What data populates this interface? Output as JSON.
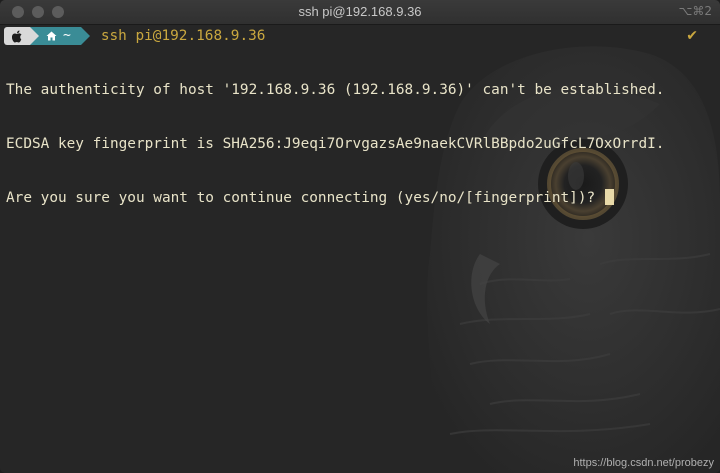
{
  "window": {
    "title": "ssh pi@192.168.9.36",
    "shortcut": "⌥⌘2"
  },
  "prompt": {
    "apple_icon": "apple-logo-icon",
    "home_icon": "home-icon",
    "dir": "~",
    "command": "ssh pi@192.168.9.36",
    "status_icon": "checkmark-icon",
    "status_glyph": "✔"
  },
  "output": {
    "line1": "The authenticity of host '192.168.9.36 (192.168.9.36)' can't be established.",
    "line2": "ECDSA key fingerprint is SHA256:J9eqi7OrvgazsAe9naekCVRlBBpdo2uGfcL7OxOrrdI.",
    "line3": "Are you sure you want to continue connecting (yes/no/[fingerprint])? "
  },
  "watermark": "https://blog.csdn.net/probezy",
  "colors": {
    "background": "#262626",
    "text": "#e8e3c8",
    "command": "#c9a73f",
    "home_segment": "#3a8c96",
    "apple_segment": "#d9d9d9"
  }
}
